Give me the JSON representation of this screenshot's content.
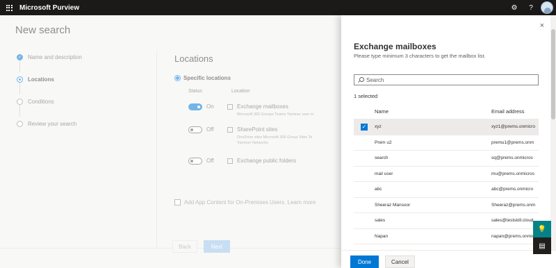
{
  "app": {
    "title": "Microsoft Purview",
    "icons": [
      "waffle-icon",
      "gear-icon",
      "help-icon",
      "avatar"
    ]
  },
  "page": {
    "title": "New search",
    "steps": [
      {
        "label": "Name and description",
        "state": "done"
      },
      {
        "label": "Locations",
        "state": "current"
      },
      {
        "label": "Conditions",
        "state": "pending"
      },
      {
        "label": "Review your search",
        "state": "pending"
      }
    ],
    "locations": {
      "title": "Locations",
      "radio_label": "Specific locations",
      "col_status": "Status",
      "col_location": "Location",
      "rows": [
        {
          "status": "On",
          "name": "Exchange mailboxes",
          "sub": "Microsoft 365 Groups        Teams        Yammer user m"
        },
        {
          "status": "Off",
          "name": "SharePoint sites",
          "sub": "OneDrive sites        Microsoft 365 Group Sites        Te",
          "sub2": "Yammer Networks"
        },
        {
          "status": "Off",
          "name": "Exchange public folders"
        }
      ],
      "add_app_label": "Add App Content for On-Premises Users. Learn more"
    },
    "footer": {
      "back": "Back",
      "next": "Next"
    }
  },
  "panel": {
    "title": "Exchange mailboxes",
    "subtitle": "Please type minimum 3 characters to get the mailbox list.",
    "search_placeholder": "Search",
    "selected_count": "1 selected",
    "columns": {
      "name": "Name",
      "email": "Email address"
    },
    "rows": [
      {
        "name": "xyz",
        "email": "xyz1@prems.onmicro",
        "selected": true
      },
      {
        "name": "Prem u2",
        "email": "premu1@prems.onm",
        "selected": false
      },
      {
        "name": "search",
        "email": "sq@prems.onmicros",
        "selected": false
      },
      {
        "name": "mail user",
        "email": "mu@prems.onmicros",
        "selected": false
      },
      {
        "name": "abc",
        "email": "abc@prems.onmicro",
        "selected": false
      },
      {
        "name": "Sheeraz Mansoor",
        "email": "Sheeraz@prems.onm",
        "selected": false
      },
      {
        "name": "sales",
        "email": "sales@testskill.cloud.",
        "selected": false
      },
      {
        "name": "Napan",
        "email": "napan@prems.onmic",
        "selected": false
      }
    ],
    "done_label": "Done",
    "cancel_label": "Cancel",
    "close_icon": "×"
  },
  "colors": {
    "accent": "#0078d4",
    "topbar": "#1b1a19",
    "teal_fab": "#038387"
  }
}
